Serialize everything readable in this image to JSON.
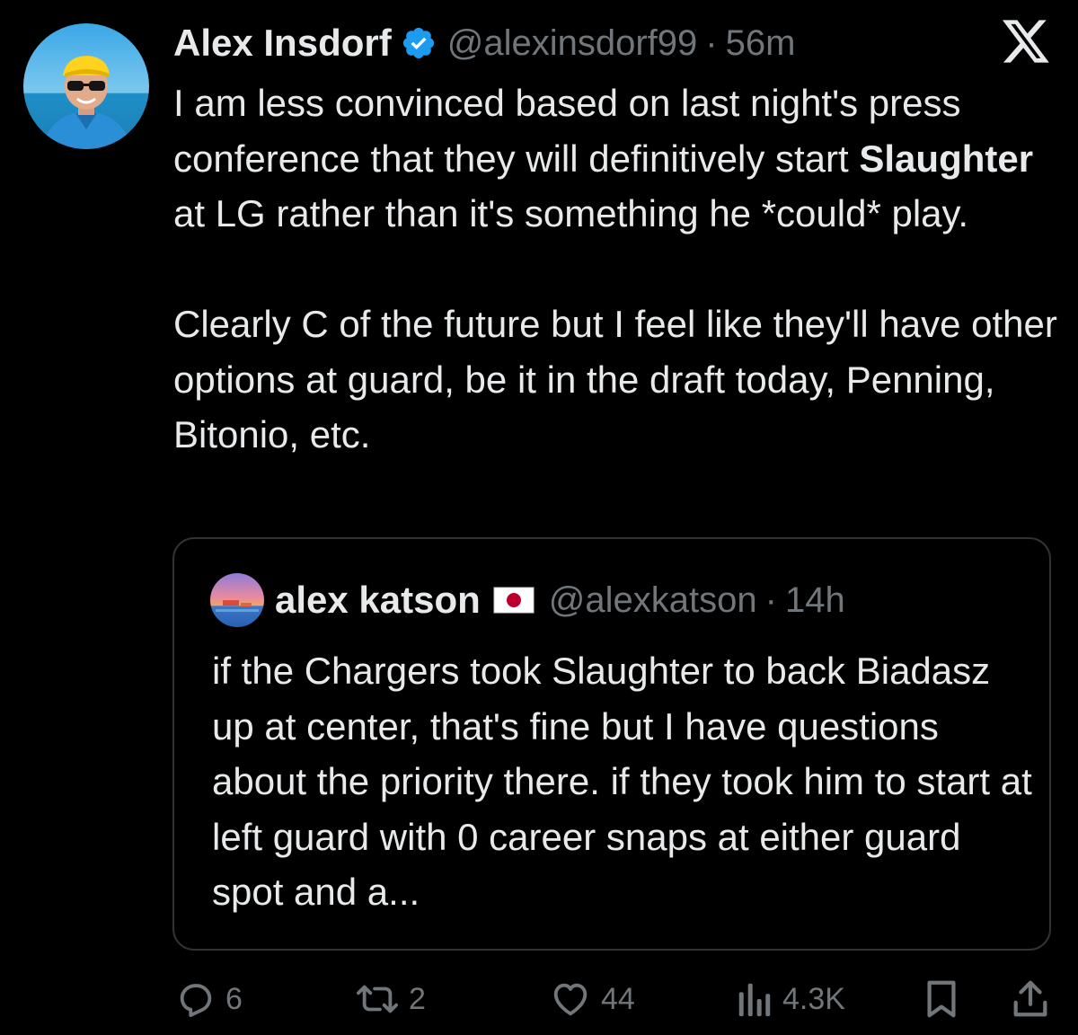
{
  "tweet": {
    "author_name": "Alex Insdorf",
    "handle": "@alexinsdorf99",
    "separator": "·",
    "time": "56m",
    "text_p1_a": "I am less convinced based on last night's press conference that they will definitively start ",
    "text_p1_bold": "Slaughter",
    "text_p1_b": " at LG rather than it's something he *could* play.",
    "text_p2": "Clearly C of the future but I feel like they'll have other options at guard, be it in the draft today, Penning, Bitonio, etc."
  },
  "quote": {
    "author_name": "alex katson",
    "handle": "@alexkatson",
    "separator": "·",
    "time": "14h",
    "text": "if the Chargers took Slaughter to back Biadasz up at center, that's fine but I have questions about the priority there. if they took him to start at left guard with 0 career snaps at either guard spot and a..."
  },
  "actions": {
    "replies": "6",
    "reposts": "2",
    "likes": "44",
    "views": "4.3K"
  },
  "icons": {
    "verified": "verified-badge-icon",
    "x_logo": "x-logo-icon",
    "flag": "japan-flag-icon",
    "reply": "reply-icon",
    "repost": "repost-icon",
    "like": "heart-icon",
    "views": "views-icon",
    "bookmark": "bookmark-icon",
    "share": "share-icon"
  },
  "colors": {
    "background": "#000000",
    "text": "#e7e9ea",
    "secondary": "#71767b",
    "verified": "#1d9bf0",
    "border": "#2f3336"
  }
}
